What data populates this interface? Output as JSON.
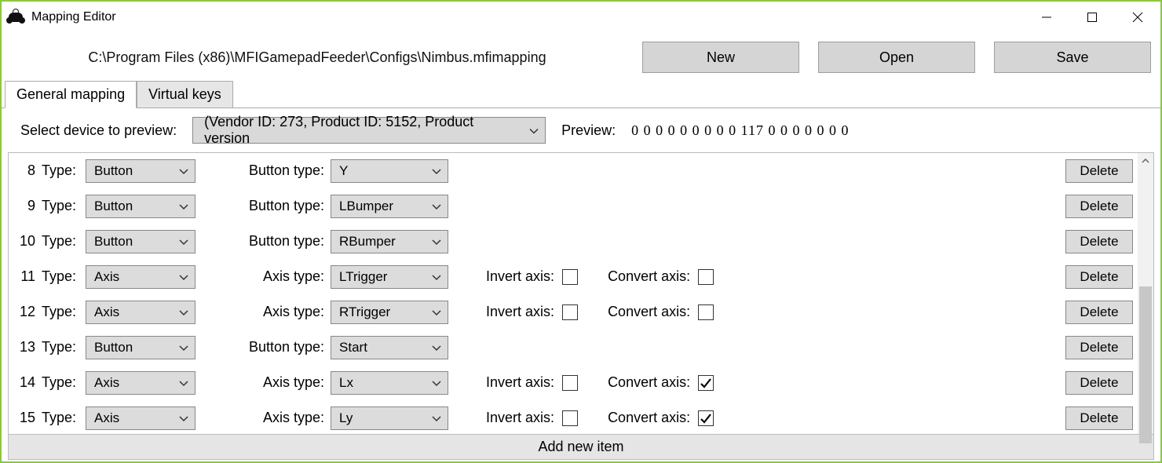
{
  "window": {
    "title": "Mapping Editor"
  },
  "toolbar": {
    "filepath": "C:\\Program Files (x86)\\MFIGamepadFeeder\\Configs\\Nimbus.mfimapping",
    "new_label": "New",
    "open_label": "Open",
    "save_label": "Save"
  },
  "tabs": {
    "general": "General mapping",
    "virtual": "Virtual keys"
  },
  "device_row": {
    "label": "Select device to preview:",
    "selected": "(Vendor ID: 273, Product ID: 5152, Product version",
    "preview_label": "Preview:",
    "preview_value": "0 0 0 0 0 0 0 0 0 117 0 0 0 0 0 0 0"
  },
  "row_labels": {
    "type": "Type:",
    "button_type": "Button type:",
    "axis_type": "Axis type:",
    "invert_axis": "Invert axis:",
    "convert_axis": "Convert axis:",
    "delete": "Delete"
  },
  "rows": [
    {
      "index": 8,
      "type": "Button",
      "subtype_label": "Button type:",
      "value": "Y",
      "is_axis": false
    },
    {
      "index": 9,
      "type": "Button",
      "subtype_label": "Button type:",
      "value": "LBumper",
      "is_axis": false
    },
    {
      "index": 10,
      "type": "Button",
      "subtype_label": "Button type:",
      "value": "RBumper",
      "is_axis": false
    },
    {
      "index": 11,
      "type": "Axis",
      "subtype_label": "Axis type:",
      "value": "LTrigger",
      "is_axis": true,
      "invert": false,
      "convert": false
    },
    {
      "index": 12,
      "type": "Axis",
      "subtype_label": "Axis type:",
      "value": "RTrigger",
      "is_axis": true,
      "invert": false,
      "convert": false
    },
    {
      "index": 13,
      "type": "Button",
      "subtype_label": "Button type:",
      "value": "Start",
      "is_axis": false
    },
    {
      "index": 14,
      "type": "Axis",
      "subtype_label": "Axis type:",
      "value": "Lx",
      "is_axis": true,
      "invert": false,
      "convert": true
    },
    {
      "index": 15,
      "type": "Axis",
      "subtype_label": "Axis type:",
      "value": "Ly",
      "is_axis": true,
      "invert": false,
      "convert": true
    }
  ],
  "footer": {
    "add_label": "Add new item"
  }
}
